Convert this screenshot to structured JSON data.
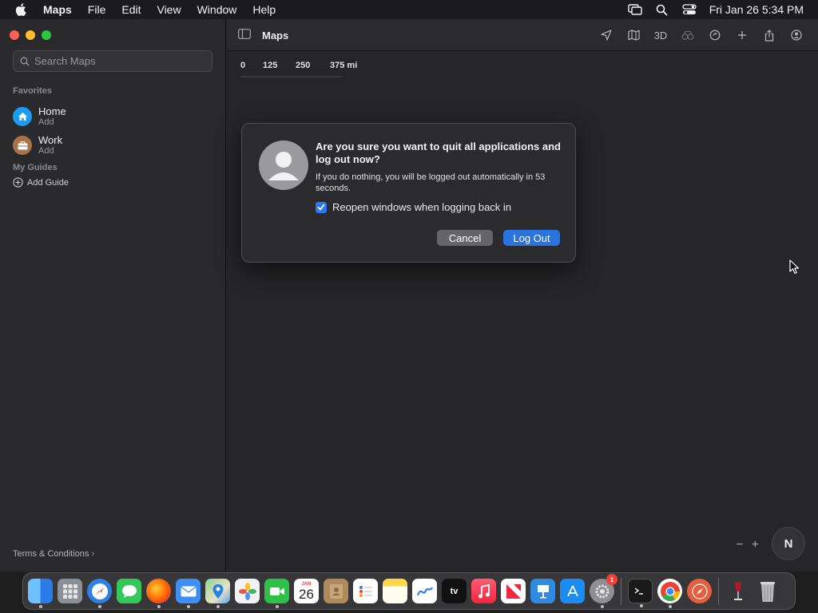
{
  "menubar": {
    "items": [
      "Maps",
      "File",
      "Edit",
      "View",
      "Window",
      "Help"
    ],
    "clock": "Fri Jan 26  5:34 PM",
    "status_icons": [
      "screen-mirroring-icon",
      "spotlight-search-icon",
      "control-center-icon"
    ]
  },
  "sidebar": {
    "search_placeholder": "Search Maps",
    "favorites_header": "Favorites",
    "favorites": [
      {
        "title": "Home",
        "subtitle": "Add",
        "icon": "home-icon",
        "color": "#1c9bf0"
      },
      {
        "title": "Work",
        "subtitle": "Add",
        "icon": "briefcase-icon",
        "color": "#a5744a"
      }
    ],
    "guides_header": "My Guides",
    "add_guide": "Add Guide",
    "terms": "Terms & Conditions"
  },
  "toolbar": {
    "title": "Maps",
    "three_d": "3D",
    "icons": [
      "location-arrow-icon",
      "map-mode-icon",
      "3d-toggle",
      "look-around-icon",
      "track-icon",
      "add-icon",
      "share-icon",
      "account-icon"
    ]
  },
  "map": {
    "scale_labels": [
      "0",
      "125",
      "250",
      "375 mi"
    ],
    "compass_label": "N",
    "zoom_out": "−",
    "zoom_in": "+"
  },
  "dialog": {
    "title": "Are you sure you want to quit all applications and log out now?",
    "body": "If you do nothing, you will be logged out automatically in 53 seconds.",
    "checkbox_label": "Reopen windows when logging back in",
    "checkbox_checked": true,
    "cancel_label": "Cancel",
    "logout_label": "Log Out"
  },
  "dock": {
    "calendar_month": "JAN",
    "calendar_day": "26",
    "tv_label": "tv",
    "settings_badge": "1",
    "apps": [
      {
        "name": "finder",
        "color": "#3d8ef0",
        "running": true
      },
      {
        "name": "launchpad",
        "color": "#8b8f96",
        "running": false
      },
      {
        "name": "safari",
        "color": "#2f7fe8",
        "running": true
      },
      {
        "name": "messages",
        "color": "#34c759",
        "running": false
      },
      {
        "name": "firefox",
        "color": "#ff7139",
        "running": true
      },
      {
        "name": "mail",
        "color": "#3b8ff6",
        "running": true
      },
      {
        "name": "maps",
        "color": "#4fa35c",
        "running": true
      },
      {
        "name": "photos",
        "color": "#f2f2f2",
        "running": false
      },
      {
        "name": "facetime",
        "color": "#30c048",
        "running": true
      },
      {
        "name": "calendar",
        "color": "#ffffff",
        "running": false
      },
      {
        "name": "contacts",
        "color": "#b08a5a",
        "running": false
      },
      {
        "name": "reminders",
        "color": "#ffffff",
        "running": false
      },
      {
        "name": "notes",
        "color": "#ffd84a",
        "running": false
      },
      {
        "name": "freeform",
        "color": "#ffffff",
        "running": false
      },
      {
        "name": "apple-tv",
        "color": "#111111",
        "running": false
      },
      {
        "name": "music",
        "color": "#fa2d48",
        "running": false
      },
      {
        "name": "news",
        "color": "#ffffff",
        "running": false
      },
      {
        "name": "keynote",
        "color": "#2f8ae0",
        "running": false
      },
      {
        "name": "app-store",
        "color": "#1b8cf2",
        "running": false
      },
      {
        "name": "system-settings",
        "color": "#8e8e93",
        "running": true
      },
      {
        "name": "terminal",
        "color": "#1a1a1a",
        "running": true
      },
      {
        "name": "chrome",
        "color": "#ffffff",
        "running": true
      },
      {
        "name": "compass-app",
        "color": "#e55f3f",
        "running": false
      },
      {
        "name": "wine",
        "color": "#ffffff",
        "running": false
      },
      {
        "name": "trash",
        "color": "#9a9a9d",
        "running": false
      }
    ]
  }
}
